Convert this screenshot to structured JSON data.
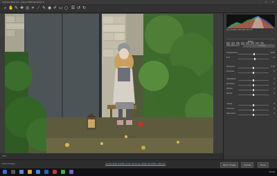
{
  "titlebar": {
    "title": "Camera Raw 9.x  -  Canon EOS 6D Mark II",
    "window_buttons": "– ☐ ✕"
  },
  "toolbar": {
    "tools": [
      "zoom-tool",
      "hand-tool",
      "white-balance-tool",
      "color-sampler-tool",
      "targeted-adjustment-tool",
      "crop-tool",
      "straighten-tool",
      "spot-removal-tool",
      "red-eye-tool",
      "adjustment-brush-tool",
      "graduated-filter-tool",
      "radial-filter-tool",
      "preferences-tool",
      "rotate-left-tool",
      "rotate-right-tool"
    ]
  },
  "status": {
    "zoom": "25%",
    "center": ""
  },
  "panel": {
    "exif": "f/2.8   1/250 s   ISO 400   70 mm",
    "section_title": "Basic",
    "white_balance_label": "White Balance",
    "white_balance_value": "As Shot",
    "rows": [
      {
        "label": "Temperature",
        "value": "5000"
      },
      {
        "label": "Tint",
        "value": "+3"
      },
      {
        "label": "Exposure",
        "value": "0.00"
      },
      {
        "label": "Contrast",
        "value": "0"
      },
      {
        "label": "Highlights",
        "value": "0"
      },
      {
        "label": "Shadows",
        "value": "0"
      },
      {
        "label": "Whites",
        "value": "0"
      },
      {
        "label": "Blacks",
        "value": "0"
      },
      {
        "label": "Clarity",
        "value": "0"
      },
      {
        "label": "Vibrance",
        "value": "0"
      },
      {
        "label": "Saturation",
        "value": "0"
      }
    ]
  },
  "footer": {
    "left": "Save Image...",
    "link": "Adobe RGB (1998); 8 bit; 5472 by 3648 (20.0MP); 300 ppi",
    "open_label": "Open Image",
    "cancel_label": "Cancel",
    "done_label": "Done"
  },
  "taskbar": {
    "clock": "12:00"
  },
  "colors": {
    "accent": "#4a8fd8",
    "panel_bg": "#383838",
    "taskbar": "#101014"
  }
}
